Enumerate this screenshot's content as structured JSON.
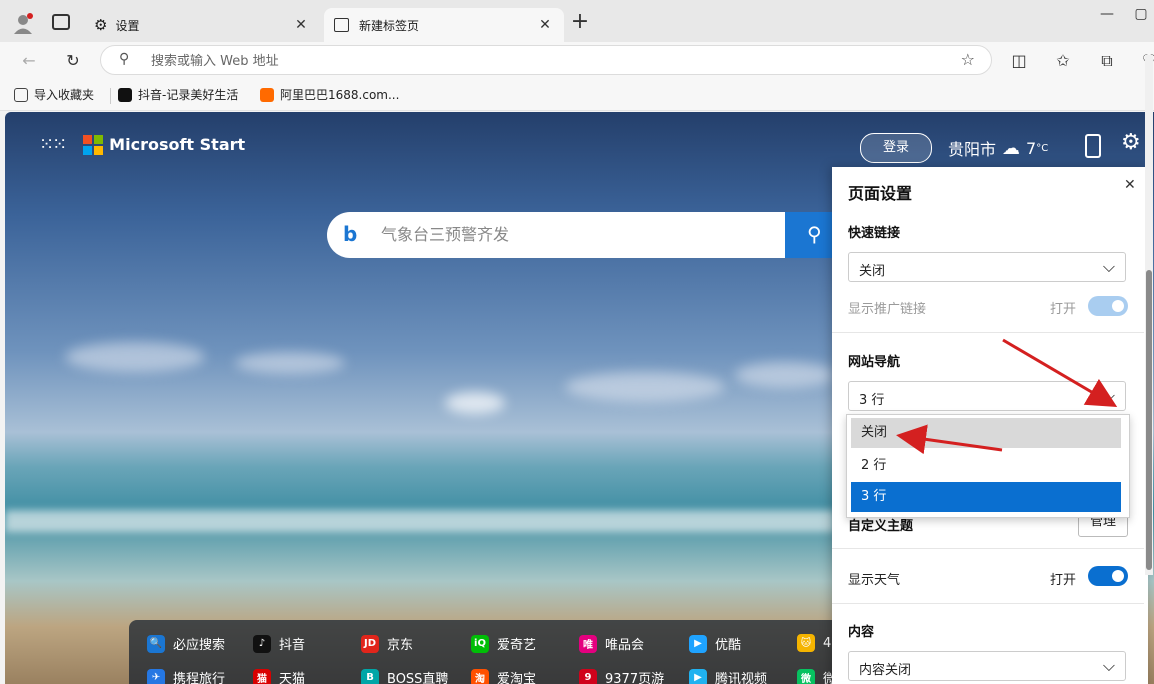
{
  "tabs": [
    {
      "label": "设置",
      "icon": "gear-icon"
    },
    {
      "label": "新建标签页",
      "icon": "newtab-icon"
    }
  ],
  "address": {
    "placeholder": "搜索或输入 Web 地址"
  },
  "bookmarks": [
    {
      "label": "导入收藏夹",
      "color": "#444444"
    },
    {
      "label": "抖音-记录美好生活",
      "color": "#111111"
    },
    {
      "label": "阿里巴巴1688.com...",
      "color": "#ff6a00"
    }
  ],
  "start": {
    "brand": "Microsoft Start",
    "login": "登录",
    "city": "贵阳市",
    "temp": "7",
    "temp_unit": "°C",
    "search_placeholder": "气象台三预警齐发"
  },
  "quicklinks": {
    "row1": [
      {
        "label": "必应搜索",
        "color": "#1b76d2",
        "glyph": "🔍"
      },
      {
        "label": "抖音",
        "color": "#111111",
        "glyph": "♪"
      },
      {
        "label": "京东",
        "color": "#e1251b",
        "glyph": "JD"
      },
      {
        "label": "爱奇艺",
        "color": "#00be06",
        "glyph": "iQ"
      },
      {
        "label": "唯品会",
        "color": "#e4007f",
        "glyph": "唯"
      },
      {
        "label": "优酷",
        "color": "#1fa3ff",
        "glyph": "▶"
      },
      {
        "label": "4",
        "color": "#f5b400",
        "glyph": "🐱"
      }
    ],
    "row2": [
      {
        "label": "携程旅行",
        "color": "#2577e3",
        "glyph": "✈"
      },
      {
        "label": "天猫",
        "color": "#d90000",
        "glyph": "猫"
      },
      {
        "label": "BOSS直聘",
        "color": "#00a6a7",
        "glyph": "B"
      },
      {
        "label": "爱淘宝",
        "color": "#ff5000",
        "glyph": "淘"
      },
      {
        "label": "9377页游",
        "color": "#d0021b",
        "glyph": "9"
      },
      {
        "label": "腾讯视频",
        "color": "#20b2f0",
        "glyph": "▶"
      },
      {
        "label": "微信",
        "color": "#07c160",
        "glyph": "微"
      }
    ]
  },
  "panel": {
    "title": "页面设置",
    "quick_links_label": "快速链接",
    "quick_links_value": "关闭",
    "promo_label": "显示推广链接",
    "promo_state": "打开",
    "site_nav_label": "网站导航",
    "site_nav_value": "3 行",
    "dropdown_options": [
      "关闭",
      "2 行",
      "3 行"
    ],
    "custom_theme_label": "自定义主题",
    "manage_button": "管理",
    "weather_label": "显示天气",
    "weather_state": "打开",
    "content_label": "内容",
    "content_value": "内容关闭"
  },
  "colors": {
    "accent": "#0a6fd0",
    "toggle_disabled": "#a9cdf0",
    "arrow": "#d42020"
  }
}
